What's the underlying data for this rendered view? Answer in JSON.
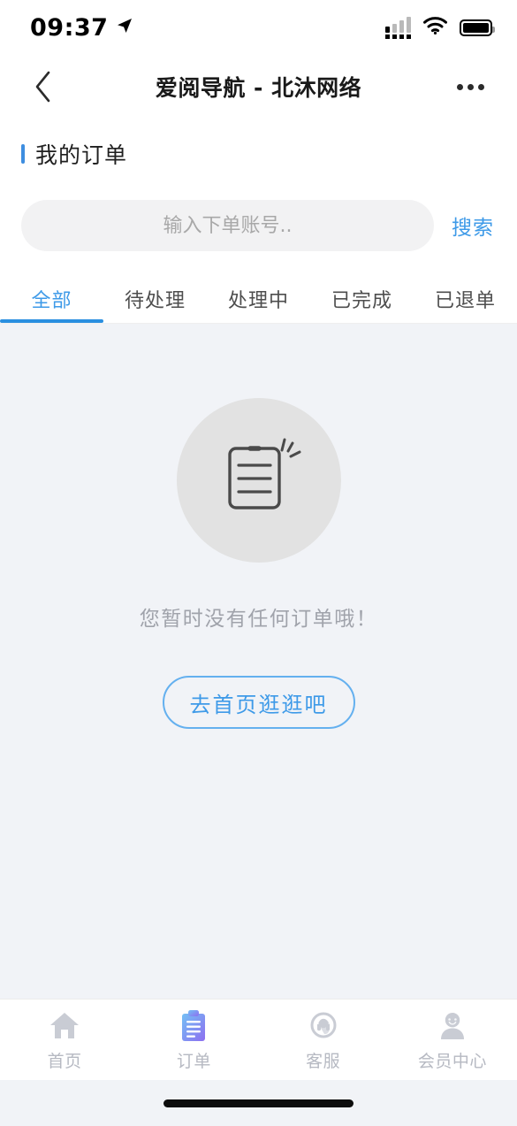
{
  "status_bar": {
    "time": "09:37",
    "location_icon": "location-arrow-icon",
    "signal_icon": "cellular-signal-icon",
    "wifi_icon": "wifi-icon",
    "battery_icon": "battery-full-icon"
  },
  "nav": {
    "back_icon": "chevron-left-icon",
    "title": "爱阅导航 - 北沐网络",
    "more_icon": "more-horizontal-icon"
  },
  "page": {
    "title": "我的订单",
    "accent_color": "#3e8ee0"
  },
  "search": {
    "value": "",
    "placeholder": "输入下单账号..",
    "button_label": "搜索",
    "button_color": "#3e9ae8"
  },
  "tabs": {
    "active_index": 0,
    "items": [
      {
        "label": "全部"
      },
      {
        "label": "待处理"
      },
      {
        "label": "处理中"
      },
      {
        "label": "已完成"
      },
      {
        "label": "已退单"
      }
    ]
  },
  "empty_state": {
    "icon": "empty-order-document-icon",
    "message": "您暂时没有任何订单哦！",
    "button_label": "去首页逛逛吧",
    "button_color": "#3e9ae8",
    "circle_color": "#e2e2e2"
  },
  "tabbar": {
    "active_index": 1,
    "items": [
      {
        "label": "首页",
        "icon": "home-icon"
      },
      {
        "label": "订单",
        "icon": "clipboard-order-icon"
      },
      {
        "label": "客服",
        "icon": "customer-service-headset-icon"
      },
      {
        "label": "会员中心",
        "icon": "member-person-icon"
      }
    ]
  },
  "home_indicator": "home-indicator-bar"
}
